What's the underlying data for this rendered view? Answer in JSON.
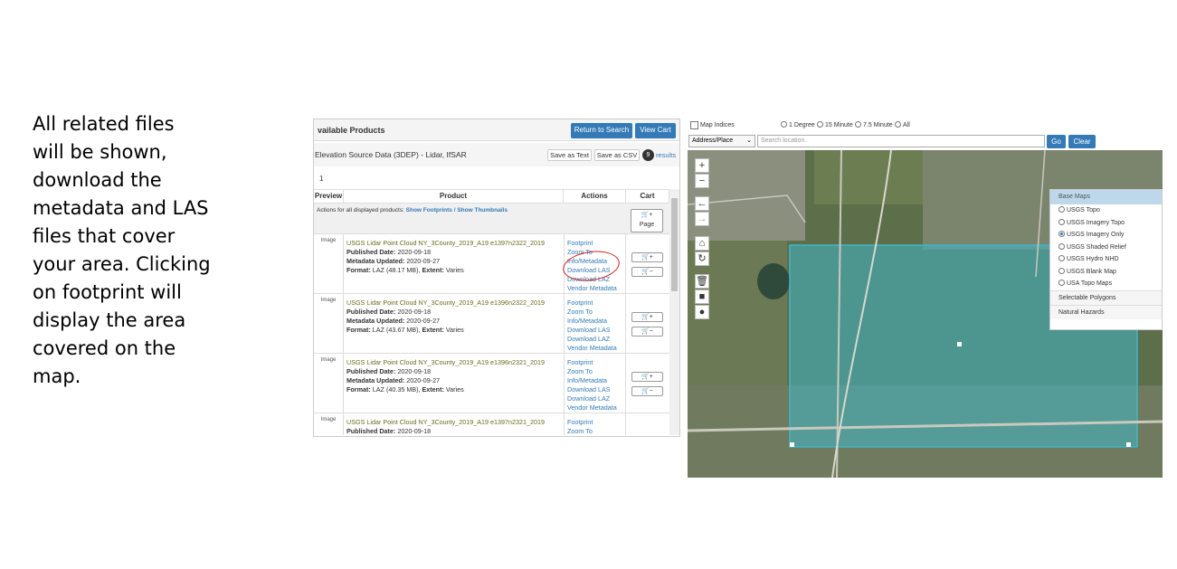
{
  "caption": [
    "All related files",
    "will be shown,",
    "download the",
    "metadata and LAS",
    "files that cover",
    "your area. Clicking",
    "on footprint will",
    "display the area",
    "covered on the",
    "map."
  ],
  "panel": {
    "title": "vailable Products",
    "return_btn": "Return to Search",
    "view_cart_btn": "View Cart",
    "dataset": "Elevation Source Data (3DEP) - Lidar, IfSAR",
    "save_text": "Save as Text",
    "save_csv": "Save as CSV",
    "results_count": "9",
    "results_label": "results",
    "page": "1",
    "columns": {
      "preview": "Preview",
      "product": "Product",
      "actions": "Actions",
      "cart": "Cart"
    },
    "actions_for_all": "Actions for all displayed products:",
    "show_footprints": "Show Footprints",
    "show_thumbnails": "/ Show Thumbnails",
    "cart_page": "Page",
    "image_label": "Image",
    "labels": {
      "published": "Published Date:",
      "updated": "Metadata Updated:",
      "format": "Format:",
      "extent": "Extent:"
    },
    "products": [
      {
        "name": "USGS Lidar Point Cloud NY_3County_2019_A19 e1397n2322_2019",
        "published": "2020-09-18",
        "updated": "2020-09-27",
        "format": "LAZ (48.17 MB),",
        "extent": "Varies"
      },
      {
        "name": "USGS Lidar Point Cloud NY_3County_2019_A19 e1396n2322_2019",
        "published": "2020-09-18",
        "updated": "2020-09-27",
        "format": "LAZ (43.67 MB),",
        "extent": "Varies"
      },
      {
        "name": "USGS Lidar Point Cloud NY_3County_2019_A19 e1396n2321_2019",
        "published": "2020-09-18",
        "updated": "2020-09-27",
        "format": "LAZ (40.35 MB),",
        "extent": "Varies"
      },
      {
        "name": "USGS Lidar Point Cloud NY_3County_2019_A19 e1397n2321_2019",
        "published": "2020-09-18"
      }
    ],
    "actions": [
      "Footprint",
      "Zoom To",
      "Info/Metadata",
      "Download LAS",
      "Download LAZ",
      "Vendor Metadata"
    ]
  },
  "map": {
    "map_indices": "Map Indices",
    "grid_options": [
      "1 Degree",
      "15 Minute",
      "7.5 Minute",
      "All"
    ],
    "address_select": "Address/Place",
    "search_placeholder": "Search location.",
    "go": "Go",
    "clear": "Clear",
    "legend_title": "Base Maps",
    "base_maps": [
      "USGS Topo",
      "USGS Imagery Topo",
      "USGS Imagery Only",
      "USGS Shaded Relief",
      "USGS Hydro NHD",
      "USGS Blank Map",
      "USA Topo Maps"
    ],
    "selected_base_map": "USGS Imagery Only",
    "sections": [
      "Selectable Polygons",
      "Natural Hazards"
    ]
  },
  "colors": {
    "primary": "#337ab7",
    "footprint": "#3fb6c9",
    "annotation": "#d02020"
  }
}
